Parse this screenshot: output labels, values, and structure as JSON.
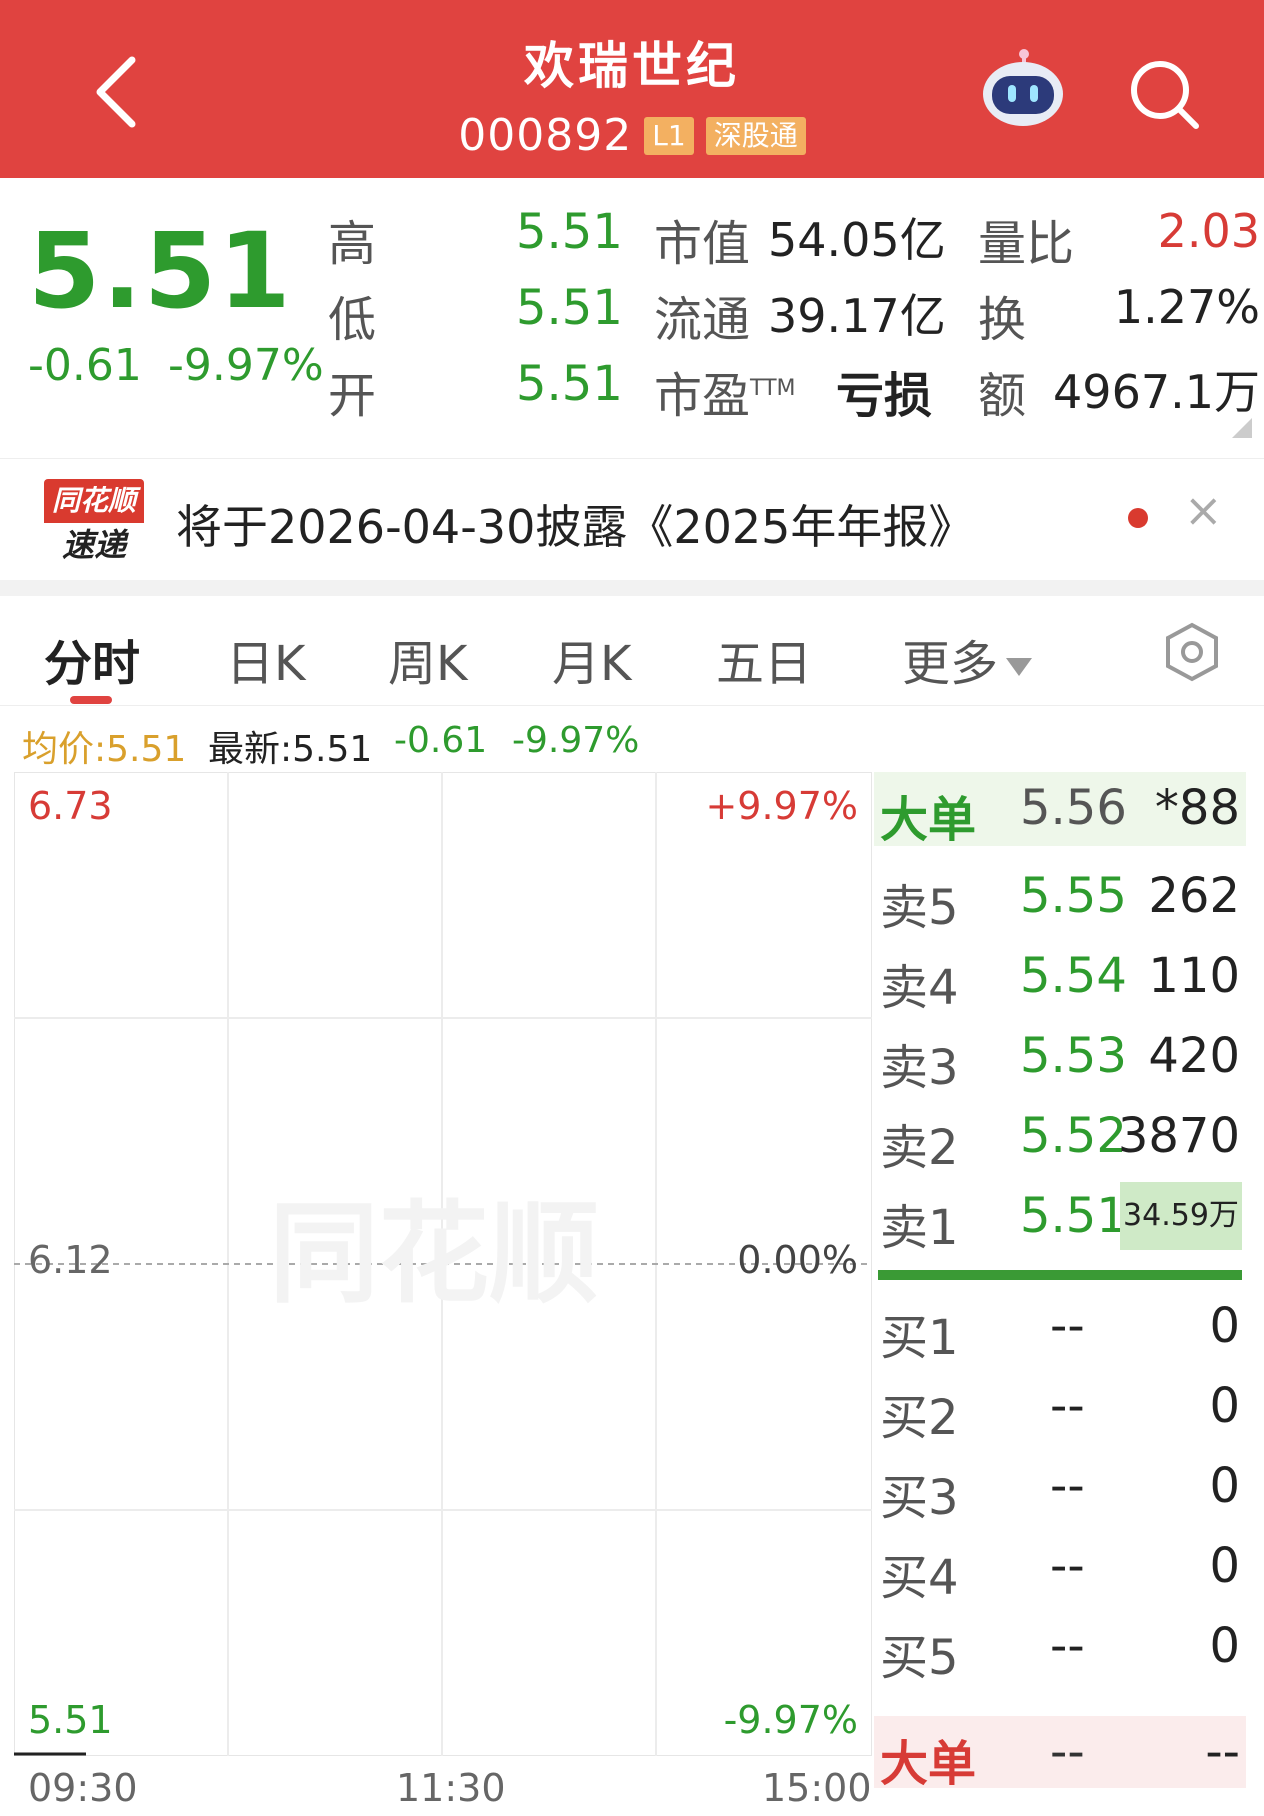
{
  "header": {
    "title": "欢瑞世纪",
    "code": "000892",
    "tag_level": "L1",
    "tag_connect": "深股通"
  },
  "quote": {
    "price": "5.51",
    "change": "-0.61",
    "change_pct": "-9.97%",
    "high_label": "高",
    "high": "5.51",
    "low_label": "低",
    "low": "5.51",
    "open_label": "开",
    "open": "5.51",
    "mktcap_label": "市值",
    "mktcap": "54.05亿",
    "float_label": "流通",
    "float": "39.17亿",
    "pe_label": "市盈",
    "pe_sup": "TTM",
    "pe": "亏损",
    "volratio_label": "量比",
    "volratio": "2.03",
    "turnover_label": "换",
    "turnover": "1.27%",
    "amount_label": "额",
    "amount": "4967.1万"
  },
  "notice": {
    "logo_top": "同花顺",
    "logo_bottom": "速递",
    "text": "将于2026-04-30披露《2025年年报》",
    "close": "×"
  },
  "tabs": [
    {
      "label": "分时",
      "active": true
    },
    {
      "label": "日K"
    },
    {
      "label": "周K"
    },
    {
      "label": "月K"
    },
    {
      "label": "五日"
    },
    {
      "label": "更多"
    }
  ],
  "info": {
    "avg": "均价:5.51",
    "latest": "最新:5.51",
    "change": "-0.61",
    "change_pct": "-9.97%"
  },
  "chart": {
    "top_price": "6.73",
    "mid_price": "6.12",
    "bottom_price": "5.51",
    "top_pct": "+9.97%",
    "mid_pct": "0.00%",
    "bottom_pct": "-9.97%",
    "watermark": "同花顺",
    "times": [
      "09:30",
      "11:30",
      "15:00"
    ]
  },
  "book": {
    "big_top": {
      "label": "大单",
      "price": "5.56",
      "qty": "*88"
    },
    "sells": [
      {
        "label": "卖5",
        "price": "5.55",
        "qty": "262"
      },
      {
        "label": "卖4",
        "price": "5.54",
        "qty": "110"
      },
      {
        "label": "卖3",
        "price": "5.53",
        "qty": "420"
      },
      {
        "label": "卖2",
        "price": "5.52",
        "qty": "3870"
      },
      {
        "label": "卖1",
        "price": "5.51",
        "qty": "34.59万"
      }
    ],
    "buys": [
      {
        "label": "买1",
        "price": "--",
        "qty": "0"
      },
      {
        "label": "买2",
        "price": "--",
        "qty": "0"
      },
      {
        "label": "买3",
        "price": "--",
        "qty": "0"
      },
      {
        "label": "买4",
        "price": "--",
        "qty": "0"
      },
      {
        "label": "买5",
        "price": "--",
        "qty": "0"
      }
    ],
    "big_bottom": {
      "label": "大单",
      "price": "--",
      "qty": "--"
    }
  },
  "colors": {
    "brand_red": "#e04340",
    "down_green": "#2e9b2e",
    "up_red": "#d73b36",
    "avg_orange": "#d9a02c"
  }
}
